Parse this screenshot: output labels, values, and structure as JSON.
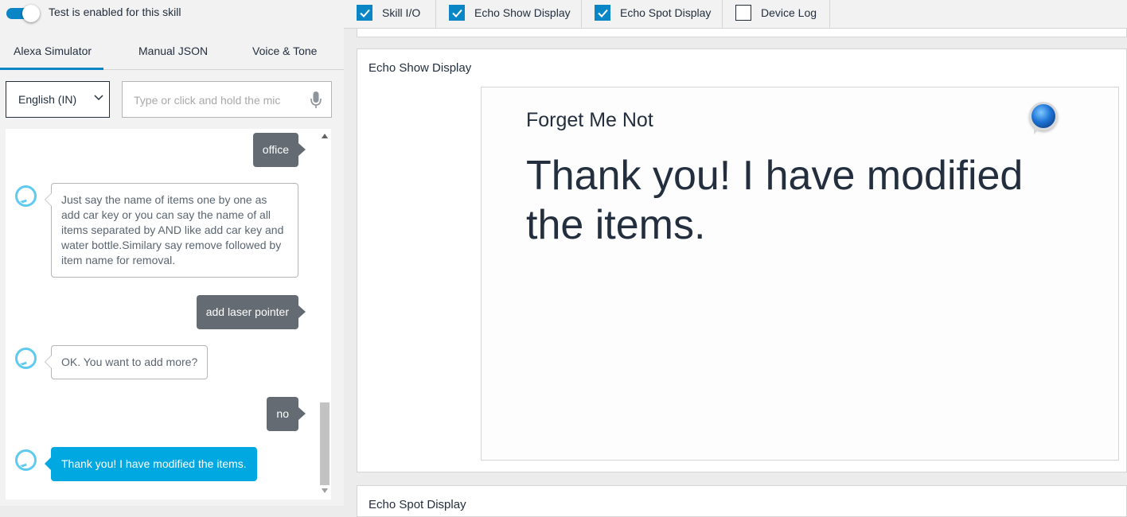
{
  "test_toggle": {
    "label": "Test is enabled for this skill",
    "enabled": true
  },
  "tabs": [
    {
      "label": "Alexa Simulator",
      "active": true
    },
    {
      "label": "Manual JSON",
      "active": false
    },
    {
      "label": "Voice & Tone",
      "active": false
    }
  ],
  "language": {
    "selected": "English (IN)"
  },
  "utterance": {
    "placeholder": "Type or click and hold the mic"
  },
  "chat": {
    "messages": [
      {
        "from": "user",
        "text": "office"
      },
      {
        "from": "alexa",
        "text": "Just say the name of items one by one as add car key or you can say the name of all items separated by AND like add car key and water bottle.Similary say remove followed by item name for removal."
      },
      {
        "from": "user",
        "text": "add laser pointer"
      },
      {
        "from": "alexa",
        "text": "OK. You want to add more?"
      },
      {
        "from": "user",
        "text": "no"
      },
      {
        "from": "alexa",
        "text": "Thank you! I have modified the items.",
        "active": true
      }
    ]
  },
  "panels": [
    {
      "label": "Skill I/O",
      "checked": true
    },
    {
      "label": "Echo Show Display",
      "checked": true
    },
    {
      "label": "Echo Spot Display",
      "checked": true
    },
    {
      "label": "Device Log",
      "checked": false
    }
  ],
  "echo_show": {
    "title": "Echo Show Display",
    "skill_name": "Forget Me Not",
    "message": "Thank you! I have modified the items."
  },
  "echo_spot": {
    "title": "Echo Spot Display"
  },
  "colors": {
    "accent": "#0a85c6",
    "alexa_bubble": "#00a8e1",
    "user_bubble": "#646b72"
  }
}
